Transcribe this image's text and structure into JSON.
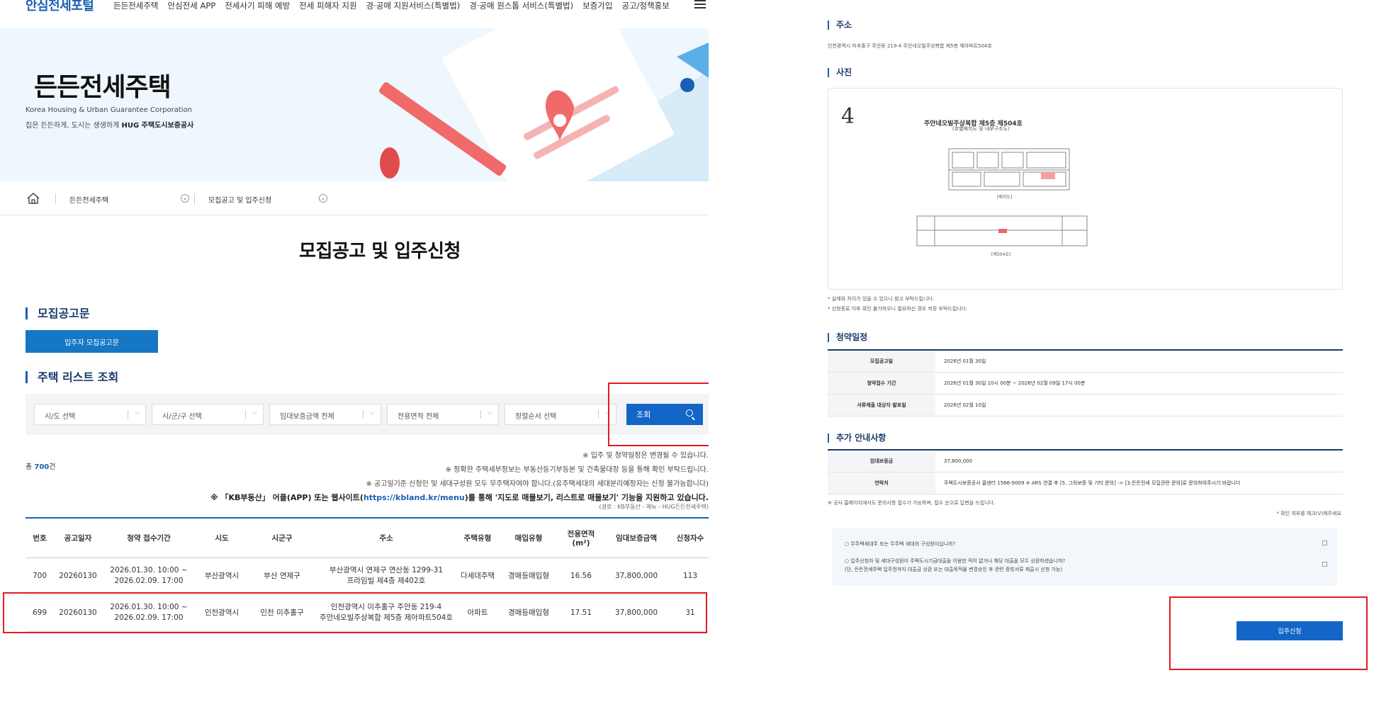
{
  "gnb": {
    "logo": "안심전세포털",
    "menu": [
      "든든전세주택",
      "안심전세 APP",
      "전세사기 피해 예방",
      "전세 피해자 지원",
      "경·공매 지원서비스(특별법)",
      "경·공매 원스톱 서비스(특별법)",
      "보증가입",
      "공고/정책홍보"
    ]
  },
  "hero": {
    "title": "든든전세주택",
    "subtitle_en": "Korea Housing & Urban Guarantee Corporation",
    "subtitle_kr_prefix": "집은 든든하게, 도시는 생생하게 ",
    "subtitle_kr_brand": "HUG 주택도시보증공사"
  },
  "breadcrumb": {
    "level1": "든든전세주택",
    "level2": "모집공고 및 입주신청"
  },
  "page_title": "모집공고 및 입주신청",
  "notice": {
    "section_title": "모집공고문",
    "button": "입주자 모집공고문"
  },
  "search": {
    "section_title": "주택 리스트 조회",
    "selects": [
      "시/도 선택",
      "시/군/구 선택",
      "임대보증금액 전체",
      "전용면적 전체",
      "정렬순서 선택"
    ],
    "button": "조회"
  },
  "total": {
    "prefix": "총 ",
    "count": "700",
    "suffix": "건"
  },
  "notes": {
    "n1": "※ 입주 및 청약일정은 변경될 수 있습니다.",
    "n2": "※ 정확한 주택세부정보는 부동산등기부등본 및 건축물대장 등을 통해 확인 부탁드립니다.",
    "n3": "※ 공고일기준 신청인 및 세대구성원 모두 무주택자여야 합니다.(유주택세대의 세대분리예정자는 신청 불가능합니다)",
    "kb_prefix": "※ 「KB부동산」 어플(APP) 또는 웹사이트(",
    "kb_link": "https://kbland.kr/menu",
    "kb_suffix": ")를 통해 '지도로 매물보기, 리스트로 매물보기' 기능을 지원하고 있습니다.",
    "src": "(경로 : KB부동산 - 메뉴 - HUG든든전세주택)"
  },
  "table": {
    "headers": [
      "번호",
      "공고일자",
      "청약 접수기간",
      "시도",
      "시군구",
      "주소",
      "주택유형",
      "매입유형",
      "전용면적",
      "임대보증금액",
      "신청자수"
    ],
    "area_unit": "(m²)",
    "rows": [
      {
        "no": "700",
        "date": "20260130",
        "p1": "2026.01.30. 10:00 ~",
        "p2": "2026.02.09. 17:00",
        "sido": "부산광역시",
        "sigungu": "부산 연제구",
        "a1": "부산광역시 연제구 연산동 1299-31",
        "a2": "프라임빌 제4층 제402호",
        "type": "다세대주택",
        "buy": "경매등매입형",
        "area": "16.56",
        "deposit": "37,800,000",
        "applicants": "113"
      },
      {
        "no": "699",
        "date": "20260130",
        "p1": "2026.01.30. 10:00 ~",
        "p2": "2026.02.09. 17:00",
        "sido": "인천광역시",
        "sigungu": "인천 미추홀구",
        "a1": "인천광역시 미추홀구 주안동 219-4",
        "a2": "주안네오빌주상복합 제5층 제아파트504호",
        "type": "아파트",
        "buy": "경매등매입형",
        "area": "17.51",
        "deposit": "37,800,000",
        "applicants": "31"
      }
    ]
  },
  "detail": {
    "address_title": "주소",
    "address": "인천광역시 미추홀구 주안동 219-4 주안네오빌주상복합 제5층 제아파트504호",
    "photo_title": "사진",
    "photo_num": "4",
    "photo_caption": "주안네오빌주상복합 제5층 제504호",
    "photo_caption2": "(호별배치도 및 내부구조도)",
    "photo_note1": "* 실제와 차이가 있을 수 있으니 참고 부탁드립니다.",
    "photo_note2": "* 신청종료 이후 확인 불가하오니 필요하신 경우 저장 부탁드립니다.",
    "schedule_title": "청약일정",
    "schedule": [
      {
        "k": "모집공고일",
        "v": "2026년 01월 30일"
      },
      {
        "k": "청약접수 기간",
        "v": "2026년 01월 30일 10시 00분 ~ 2026년 02월 09일 17시 00분"
      },
      {
        "k": "서류제출 대상자 발표일",
        "v": "2026년 02월 10일"
      }
    ],
    "extra_title": "추가 안내사항",
    "extra": [
      {
        "k": "임대보증금",
        "v": "37,800,000"
      },
      {
        "k": "연락처",
        "v": "주택도시보증공사 콜센터 1566-9009 ※ ARS 연결 후 [5. 그외보증 및 기타 문의] -> [3.든든전세 모집관련 문의]로 문의하여주시기 바랍니다"
      }
    ],
    "extra_note": "※ 공사 홈페이지에서도 문의사항 접수가 가능하며, 접수 순으로 답변을 드립니다.",
    "confirm_note": "* 확인 여부를 체크(V)해주세요.",
    "q1": "○ 무주택세대주 또는 무주택 세대의 구성원이십니까?",
    "q2": "○ 입주신청자 및 세대구성원이 주택도시기금대출을 이용한 적이 없거나 해당 대출을 모두 상환하셨습니까?",
    "q2b": "(단, 든든전세주택 입주전까지 대출금 상환 또는 대출목적물 변경승인 후 관련 증빙서류 제출시 신청 가능)",
    "apply_button": "입주신청"
  },
  "colors": {
    "primary": "#1366c7",
    "highlight": "#e21b23",
    "navy": "#1b3a6b"
  }
}
